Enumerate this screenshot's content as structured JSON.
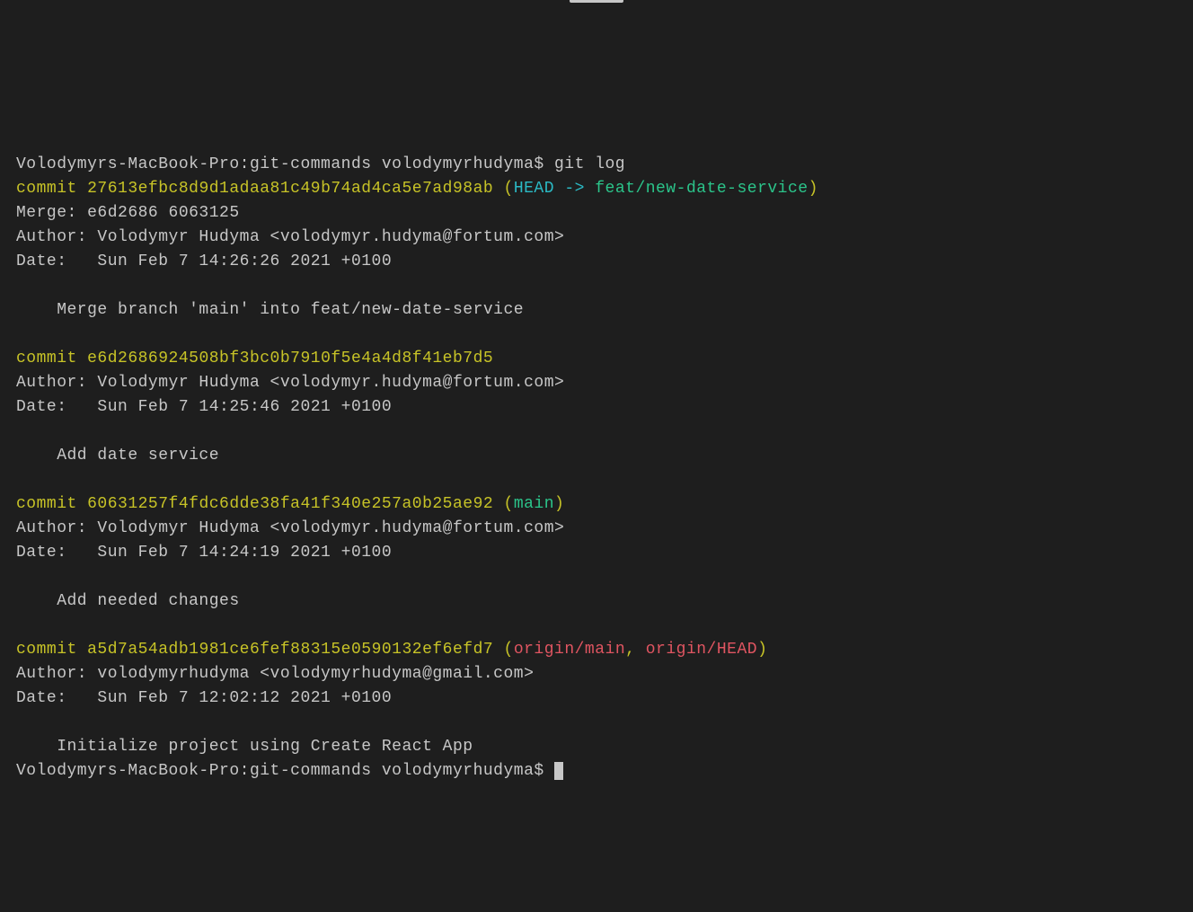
{
  "prompt1": {
    "host": "Volodymyrs-MacBook-Pro:git-commands volodymyrhudyma$ ",
    "cmd": "git log"
  },
  "commit1": {
    "label": "commit ",
    "hash": "27613efbc8d9d1adaa81c49b74ad4ca5e7ad98ab",
    "refOpen": " (",
    "head": "HEAD -> ",
    "branch": "feat/new-date-service",
    "refClose": ")",
    "merge": "Merge: e6d2686 6063125",
    "author": "Author: Volodymyr Hudyma <volodymyr.hudyma@fortum.com>",
    "date": "Date:   Sun Feb 7 14:26:26 2021 +0100",
    "message": "    Merge branch 'main' into feat/new-date-service"
  },
  "commit2": {
    "label": "commit ",
    "hash": "e6d2686924508bf3bc0b7910f5e4a4d8f41eb7d5",
    "author": "Author: Volodymyr Hudyma <volodymyr.hudyma@fortum.com>",
    "date": "Date:   Sun Feb 7 14:25:46 2021 +0100",
    "message": "    Add date service"
  },
  "commit3": {
    "label": "commit ",
    "hash": "60631257f4fdc6dde38fa41f340e257a0b25ae92",
    "refOpen": " (",
    "branch": "main",
    "refClose": ")",
    "author": "Author: Volodymyr Hudyma <volodymyr.hudyma@fortum.com>",
    "date": "Date:   Sun Feb 7 14:24:19 2021 +0100",
    "message": "    Add needed changes"
  },
  "commit4": {
    "label": "commit ",
    "hash": "a5d7a54adb1981ce6fef88315e0590132ef6efd7",
    "refOpen": " (",
    "remote1": "origin/main",
    "sep": ", ",
    "remote2": "origin/HEAD",
    "refClose": ")",
    "author": "Author: volodymyrhudyma <volodymyrhudyma@gmail.com>",
    "date": "Date:   Sun Feb 7 12:02:12 2021 +0100",
    "message": "    Initialize project using Create React App"
  },
  "prompt2": {
    "host": "Volodymyrs-MacBook-Pro:git-commands volodymyrhudyma$ "
  }
}
